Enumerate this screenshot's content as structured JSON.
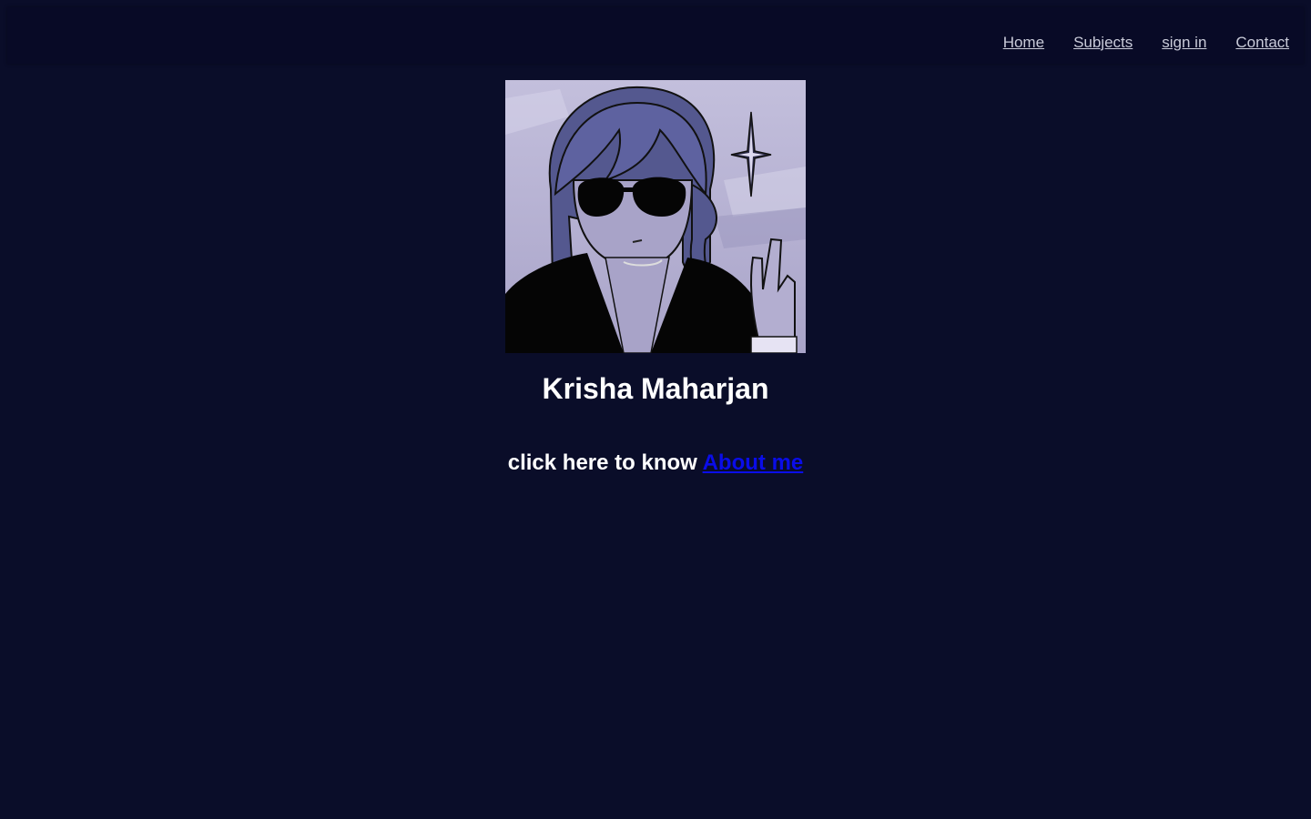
{
  "nav": {
    "items": [
      {
        "label": "Home"
      },
      {
        "label": "Subjects"
      },
      {
        "label": "sign in"
      },
      {
        "label": "Contact"
      }
    ]
  },
  "profile": {
    "name": "Krisha Maharjan",
    "avatar_icon": "profile-illustration-icon"
  },
  "about": {
    "prefix": "click here to know",
    "link_label": "About me"
  },
  "colors": {
    "background": "#0a0d29",
    "nav_background": "#080a26",
    "nav_link": "#c9cbd9",
    "text": "#ffffff",
    "link": "#0a0de8"
  }
}
